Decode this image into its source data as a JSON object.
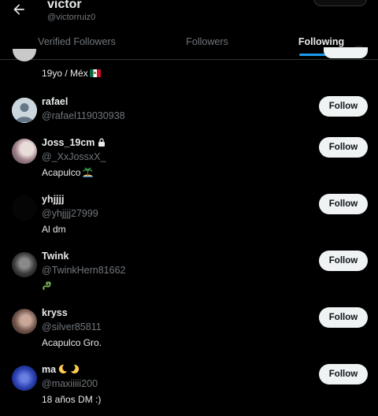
{
  "header": {
    "name": "victor",
    "handle": "@victorruiz0",
    "back_icon": "back-arrow-icon"
  },
  "tabs": [
    {
      "label": "Verified Followers",
      "active": false
    },
    {
      "label": "Followers",
      "active": false
    },
    {
      "label": "Following",
      "active": true
    }
  ],
  "colors": {
    "accent": "#1d9bf0",
    "background": "#000000",
    "muted": "#71767b",
    "text": "#e7e9ea",
    "button_bg": "#eff3f4"
  },
  "partial_row": {
    "bio": "19yo / Méx",
    "bio_emoji": "mexico-flag-icon"
  },
  "users": [
    {
      "name": "rafael",
      "handle": "@rafael119030938",
      "bio": "",
      "follow_label": "Follow",
      "avatar": "default-avatar-icon"
    },
    {
      "name": "Joss_19cm",
      "handle": "@_XxJossxX_",
      "bio": "Acapulco",
      "bio_emoji": "desert-island-icon",
      "name_icon": "lock-icon",
      "follow_label": "Follow",
      "avatar": "photo-avatar"
    },
    {
      "name": "yhjjjj",
      "handle": "@yhjjjj27999",
      "bio": "Al dm",
      "follow_label": "Follow",
      "avatar": "dark-photo-avatar"
    },
    {
      "name": "Twink",
      "handle": "@TwinkHern81662",
      "bio": "",
      "bio_emoji": "dragon-icon",
      "follow_label": "Follow",
      "avatar": "photo-avatar"
    },
    {
      "name": "kryss",
      "handle": "@silver85811",
      "bio": "Acapulco Gro.",
      "follow_label": "Follow",
      "avatar": "photo-avatar"
    },
    {
      "name": "ma",
      "handle": "@maxiiiii200",
      "bio": "18 años DM :)",
      "name_emoji": "moon-icons",
      "follow_label": "Follow",
      "avatar": "blue-photo-avatar"
    }
  ]
}
